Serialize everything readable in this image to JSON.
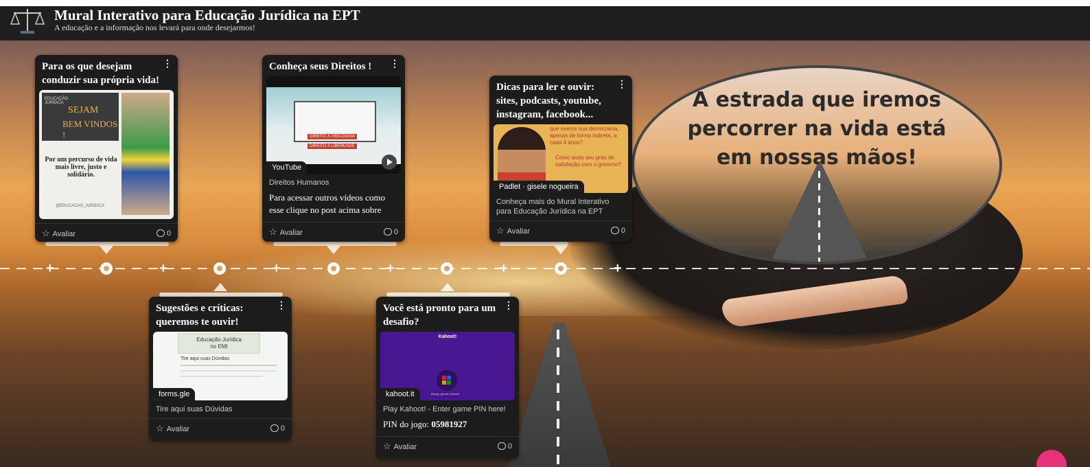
{
  "header": {
    "title": "Mural Interativo para Educação Jurídica na EPT",
    "subtitle": "A educação e a informação nos levará para onde desejarmos!"
  },
  "banner": {
    "text_line1": "A estrada que iremos",
    "text_line2": "percorrer na vida está",
    "text_line3": "em nossas mãos!"
  },
  "cards": [
    {
      "title": "Para os que desejam conduzir sua própria vida!",
      "thumb_heading1": "SEJAM",
      "thumb_heading2": "BEM VINDOS !",
      "thumb_brand": "EDUCAÇÃO JURÍDICA",
      "thumb_text": "Por um percurso de vida mais livre, justo e solidário.",
      "thumb_footer": "@EDUCACAO_JURIDICA",
      "rate_label": "Avaliar",
      "comments": "0"
    },
    {
      "title": "Conheça seus Direitos !",
      "badge": "YouTube",
      "sign1": "DIREITO À VIDA DIGNA",
      "sign2": "DIREITO À LIBERDADE",
      "caption": "Direitos Humanos",
      "description": "Para acessar outros vídeos como esse clique no post acima sobre",
      "rate_label": "Avaliar",
      "comments": "0"
    },
    {
      "title": "Dicas para ler e ouvir: sites, podcasts, youtube, instagram, facebook...",
      "thumb_text1": "que exerce sua democracia, apenas de forma indireta, a cada 4 anos?",
      "thumb_text2": "Como anda seu grau de satisfação com o governo?",
      "badge": "Padlet · gisele nogueira",
      "caption": "Conheça mais do Mural Interativo para Educação Jurídica na EPT",
      "rate_label": "Avaliar",
      "comments": "0"
    },
    {
      "title": "Sugestões e críticas: queremos te ouvir!",
      "thumb_header": "Educação Jurídica no EMI",
      "thumb_subheader": "Tire aqui suas Dúvidas",
      "badge": "forms.gle",
      "caption": "Tire aqui suas Dúvidas",
      "rate_label": "Avaliar",
      "comments": "0"
    },
    {
      "title": "Você está pronto para um desafio?",
      "thumb_logo": "Kahoot!",
      "thumb_sub": "Ready, get set, Kahoot!",
      "badge": "kahoot.it",
      "caption": "Play Kahoot! - Enter game PIN here!",
      "pin_label": "PIN do jogo:",
      "pin_value": "05981927",
      "rate_label": "Avaliar",
      "comments": "0"
    }
  ]
}
